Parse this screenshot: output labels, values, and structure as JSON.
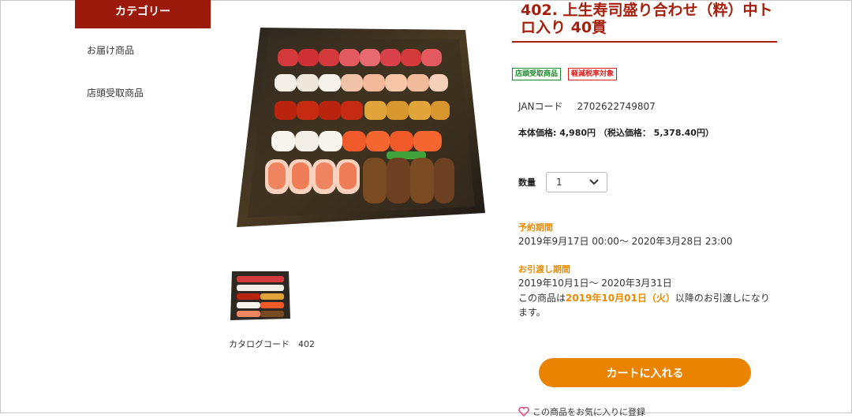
{
  "sidebar": {
    "header": "カテゴリー",
    "items": [
      {
        "label": "お届け商品"
      },
      {
        "label": "店頭受取商品"
      }
    ]
  },
  "product": {
    "title": "402. 上生寿司盛り合わせ（粋）中トロ入り 40貫",
    "badges": [
      "店頭受取商品",
      "軽減税率対象"
    ],
    "jan_label": "JANコード",
    "jan_value": "2702622749807",
    "price_text": "本体価格: 4,980円 （税込価格： 5,378.40円）",
    "quantity_label": "数量",
    "quantity_value": "1",
    "catalog_text": "カタログコード　402"
  },
  "reservation": {
    "label": "予約期間",
    "text": "2019年9月17日 00:00～ 2020年3月28日 23:00"
  },
  "pickup": {
    "label": "お引渡し期間",
    "period": "2019年10月1日～ 2020年3月31日",
    "note_before": "この商品は",
    "note_highlight": "2019年10月01日（火）",
    "note_after": "以降のお引渡しになります。"
  },
  "cart_button": "カートに入れる",
  "favorite_text": "この商品をお気に入りに登録",
  "colors": {
    "brand": "#9b1a0c",
    "accent": "#ea8300",
    "title": "#a5200c"
  }
}
